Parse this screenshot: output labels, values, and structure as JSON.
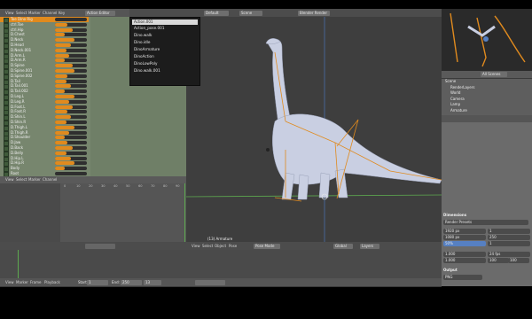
{
  "graph_editor": {
    "menus": [
      "View",
      "Select",
      "Marker",
      "Channel",
      "Key"
    ],
    "mode": "Action Editor",
    "channels": [
      {
        "label": "Toe Dino Rig",
        "fill": 0.0
      },
      {
        "label": "ctrl.Toe",
        "fill": 0.4
      },
      {
        "label": "ctrl.Hip",
        "fill": 0.55
      },
      {
        "label": "D.Chest",
        "fill": 0.3
      },
      {
        "label": "D.Neck",
        "fill": 0.6
      },
      {
        "label": "D.Head",
        "fill": 0.5
      },
      {
        "label": "D.Neck.001",
        "fill": 0.35
      },
      {
        "label": "D.Arm.L",
        "fill": 0.45
      },
      {
        "label": "D.Arm.R",
        "fill": 0.3
      },
      {
        "label": "D.Spine",
        "fill": 0.55
      },
      {
        "label": "D.Spine.001",
        "fill": 0.6
      },
      {
        "label": "D.Spine.002",
        "fill": 0.4
      },
      {
        "label": "D.Tail",
        "fill": 0.35
      },
      {
        "label": "D.Tail.001",
        "fill": 0.5
      },
      {
        "label": "D.Tail.002",
        "fill": 0.3
      },
      {
        "label": "D.Leg.L",
        "fill": 0.6
      },
      {
        "label": "D.Leg.R",
        "fill": 0.45
      },
      {
        "label": "D.Foot.L",
        "fill": 0.55
      },
      {
        "label": "D.Foot.R",
        "fill": 0.4
      },
      {
        "label": "D.Shin.L",
        "fill": 0.5
      },
      {
        "label": "D.Shin.R",
        "fill": 0.35
      },
      {
        "label": "D.Thigh.L",
        "fill": 0.6
      },
      {
        "label": "D.Thigh.R",
        "fill": 0.45
      },
      {
        "label": "D.Shoulder",
        "fill": 0.3
      },
      {
        "label": "D.Jaw",
        "fill": 0.4
      },
      {
        "label": "D.Back",
        "fill": 0.55
      },
      {
        "label": "D.Belly",
        "fill": 0.35
      },
      {
        "label": "D.Hip.L",
        "fill": 0.5
      },
      {
        "label": "D.Hip.R",
        "fill": 0.6
      },
      {
        "label": "Body",
        "fill": 0.3
      },
      {
        "label": "Root",
        "fill": 0.0
      }
    ]
  },
  "dopesheet": {
    "menus": [
      "View",
      "Select",
      "Marker",
      "Channel"
    ],
    "ruler": [
      "0",
      "10",
      "20",
      "30",
      "40",
      "50",
      "60",
      "70",
      "80",
      "90"
    ]
  },
  "dropdown": {
    "items": [
      "Action.001",
      "Action_pose.001",
      "Dino.walk",
      "Dino.idle",
      "DinoArmature",
      "DinoAction",
      "DinoLowPoly",
      "Dino.walk.001"
    ],
    "selected": "Action.001"
  },
  "viewport": {
    "menus": [
      "View",
      "Select",
      "Object",
      "Pose"
    ],
    "mode": "Pose Mode",
    "status": "(13) Armature",
    "buttons": [
      "Global",
      "Layers"
    ]
  },
  "top_header": {
    "scene_fields": [
      "Default",
      "Scene"
    ],
    "engine": "Blender Render"
  },
  "outliner": {
    "search_placeholder": "All Scenes",
    "items": [
      "Scene",
      "RenderLayers",
      "World",
      "Camera",
      "Lamp",
      "Armature"
    ]
  },
  "properties": {
    "section_dimensions": "Dimensions",
    "section_output": "Output",
    "preset": "Render Presets",
    "resolution_x": "1920 px",
    "resolution_y": "1080 px",
    "percent": "50%",
    "frame_start": "1",
    "frame_end": "250",
    "frame_step": "1",
    "fps": "24 fps",
    "aspect_x": "1.000",
    "aspect_y": "1.000",
    "time_stretch_old": "100",
    "time_stretch_new": "100",
    "output_format": "PNG"
  },
  "timeline": {
    "menus": [
      "View",
      "Marker",
      "Frame",
      "Playback"
    ],
    "start_label": "Start:",
    "start": "1",
    "end_label": "End:",
    "end": "250",
    "current": "13"
  },
  "colors": {
    "accent": "#e08a1e",
    "graph_bg": "#77866e",
    "viewport_bg": "#3e3e3e",
    "selection_blue": "#5680c2"
  }
}
